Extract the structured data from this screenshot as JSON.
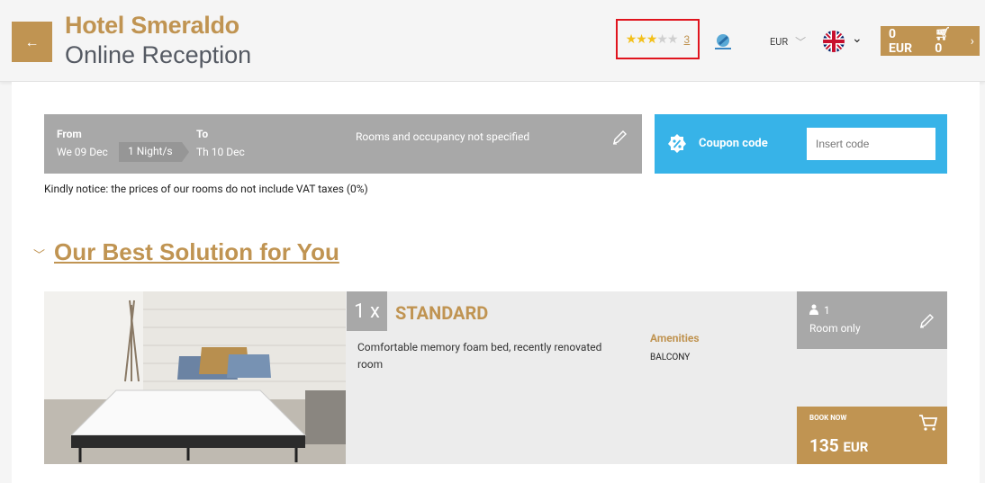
{
  "header": {
    "hotel_name": "Hotel Smeraldo",
    "subtitle": "Online Reception",
    "back_icon": "arrow-left-icon",
    "rating": {
      "stars_filled": 3,
      "stars_total": 5,
      "review_count": "3"
    },
    "currency": "EUR",
    "language_flag": "uk-flag-icon",
    "cart": {
      "total": "0 EUR",
      "items": "0"
    }
  },
  "stay": {
    "from_label": "From",
    "from_date": "We 09 Dec",
    "nights": "1 Night/s",
    "to_label": "To",
    "to_date": "Th 10 Dec",
    "rooms_text": "Rooms and occupancy not specified"
  },
  "coupon": {
    "label": "Coupon code",
    "placeholder": "Insert code"
  },
  "notice": "Kindly notice: the prices of our rooms do not include VAT taxes (0%)",
  "best_solution": {
    "title": "Our Best Solution for You",
    "room": {
      "qty": "1 x",
      "name": "STANDARD",
      "description": "Comfortable memory foam bed, recently renovated room",
      "amenities_label": "Amenities",
      "amenities": [
        "BALCONY"
      ],
      "guests": "1",
      "board": "Room only",
      "book_label": "BOOK NOW",
      "price": "135",
      "price_currency": "EUR"
    }
  },
  "colors": {
    "gold": "#c09452",
    "gray_bar": "#a8a8a8",
    "coupon_blue": "#37b3e8",
    "star": "#f3c01b"
  }
}
